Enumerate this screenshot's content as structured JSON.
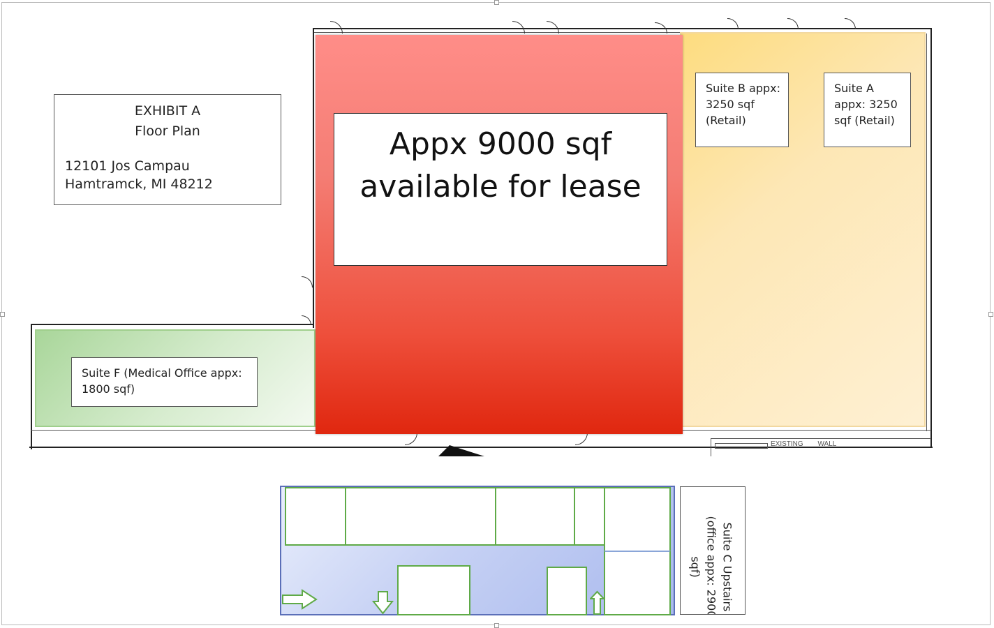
{
  "exhibit": {
    "title": "EXHIBIT A",
    "subtitle": "Floor Plan",
    "address_line1": "12101 Jos Campau",
    "address_line2": "Hamtramck, MI 48212"
  },
  "lease_notice": {
    "line1": "Appx 9000 sqf",
    "line2": "available for lease"
  },
  "suites": {
    "b": "Suite B appx: 3250 sqf (Retail)",
    "a": "Suite A appx: 3250 sqf (Retail)",
    "f": "Suite F (Medical Office appx: 1800 sqf)",
    "c": "Suite C Upstairs (office appx: 2900 sqf)"
  },
  "drawing_notes": {
    "existing_wall": "EXISTING WALL",
    "north_marker": "N"
  },
  "colors": {
    "red_top": "#ff8b86",
    "red_bottom": "#e02a12",
    "orange": "#fde9b8",
    "green": "#c9e6bc",
    "blue": "#b5c4f0"
  }
}
